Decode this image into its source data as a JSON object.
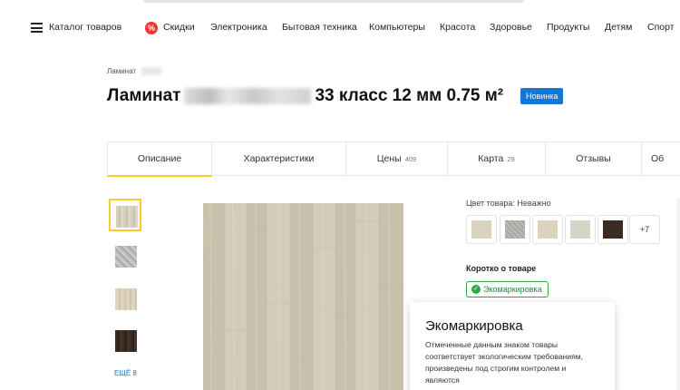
{
  "nav": {
    "catalog_label": "Каталог товаров",
    "sale_icon": "sale-badge-icon",
    "links": [
      "Скидки",
      "Электроника",
      "Бытовая техника",
      "Компьютеры",
      "Красота",
      "Здоровье",
      "Продукты",
      "Детям",
      "Спорт"
    ]
  },
  "breadcrumb": {
    "first": "Ламинат"
  },
  "product": {
    "title_prefix": "Ламинат",
    "title_suffix": "33 класс 12 мм 0.75 м²",
    "badge": "Новинка"
  },
  "tabs": [
    {
      "label": "Описание",
      "count": ""
    },
    {
      "label": "Характеристики",
      "count": ""
    },
    {
      "label": "Цены",
      "count": "409"
    },
    {
      "label": "Карта",
      "count": "29"
    },
    {
      "label": "Отзывы",
      "count": ""
    },
    {
      "label": "Об",
      "count": ""
    }
  ],
  "gallery": {
    "more_label": "ЕЩЁ 8"
  },
  "color": {
    "label": "Цвет товара:",
    "value": "Неважно",
    "more": "+7",
    "swatches": [
      "#d9d2bf",
      "#bdbbb6",
      "#dcd3bd",
      "#d6d3c7",
      "#3b2b22"
    ]
  },
  "about": {
    "heading": "Коротко о товаре",
    "eco_label": "Экомаркировка"
  },
  "popup": {
    "title": "Экомаркировка",
    "text": "Отмеченные данным знаком товары соответствует экологическим требованиям, произведены под строгим контролем и являются"
  },
  "colors": {
    "accent": "#f7cd2a",
    "badge": "#1676d2",
    "eco": "#2ea84a"
  }
}
